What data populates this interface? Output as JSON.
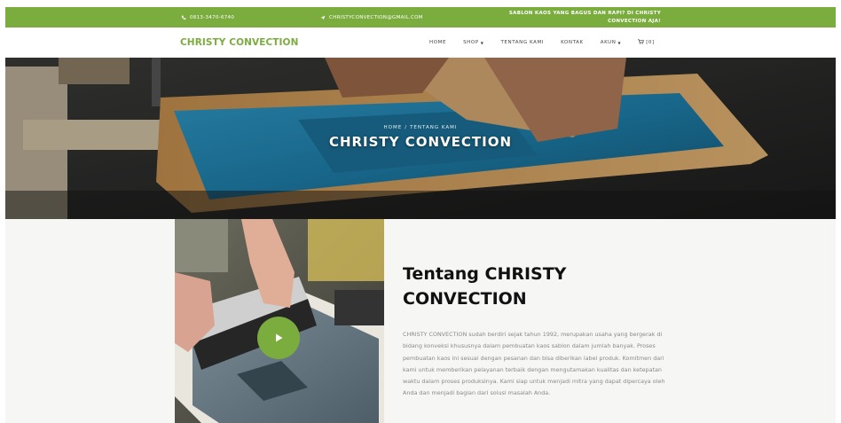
{
  "topbar": {
    "phone": "0813-3470-6740",
    "email": "CHRISTYCONVECTION@GMAIL.COM",
    "tagline": "SABLON KAOS YANG BAGUS DAN RAPI? DI CHRISTY CONVECTION AJA!",
    "color": "#7aac3e"
  },
  "navbar": {
    "brand": "CHRISTY CONVECTION",
    "items": [
      {
        "label": "HOME",
        "dropdown": false
      },
      {
        "label": "SHOP",
        "dropdown": true
      },
      {
        "label": "TENTANG KAMI",
        "dropdown": false
      },
      {
        "label": "KONTAK",
        "dropdown": false
      },
      {
        "label": "AKUN",
        "dropdown": true
      }
    ],
    "cart_count": "[0]"
  },
  "hero": {
    "breadcrumb_home": "HOME",
    "breadcrumb_current": "TENTANG KAMI",
    "title": "CHRISTY CONVECTION"
  },
  "about": {
    "heading": "Tentang CHRISTY CONVECTION",
    "body": "CHRISTY CONVECTION sudah berdiri sejak tahun 1992, merupakan usaha yang bergerak di bidang konveksi khususnya dalam pembuatan kaos sablon dalam jumlah banyak. Proses pembuatan kaos ini sesuai dengan pesanan dan bisa diberikan label produk. Komitmen dari kami untuk memberikan pelayanan terbaik dengan mengutamakan kualitas dan ketepatan waktu dalam proses produksinya. Kami siap untuk menjadi mitra yang dapat dipercaya oleh Anda dan menjadi bagian dari solusi masalah Anda."
  }
}
